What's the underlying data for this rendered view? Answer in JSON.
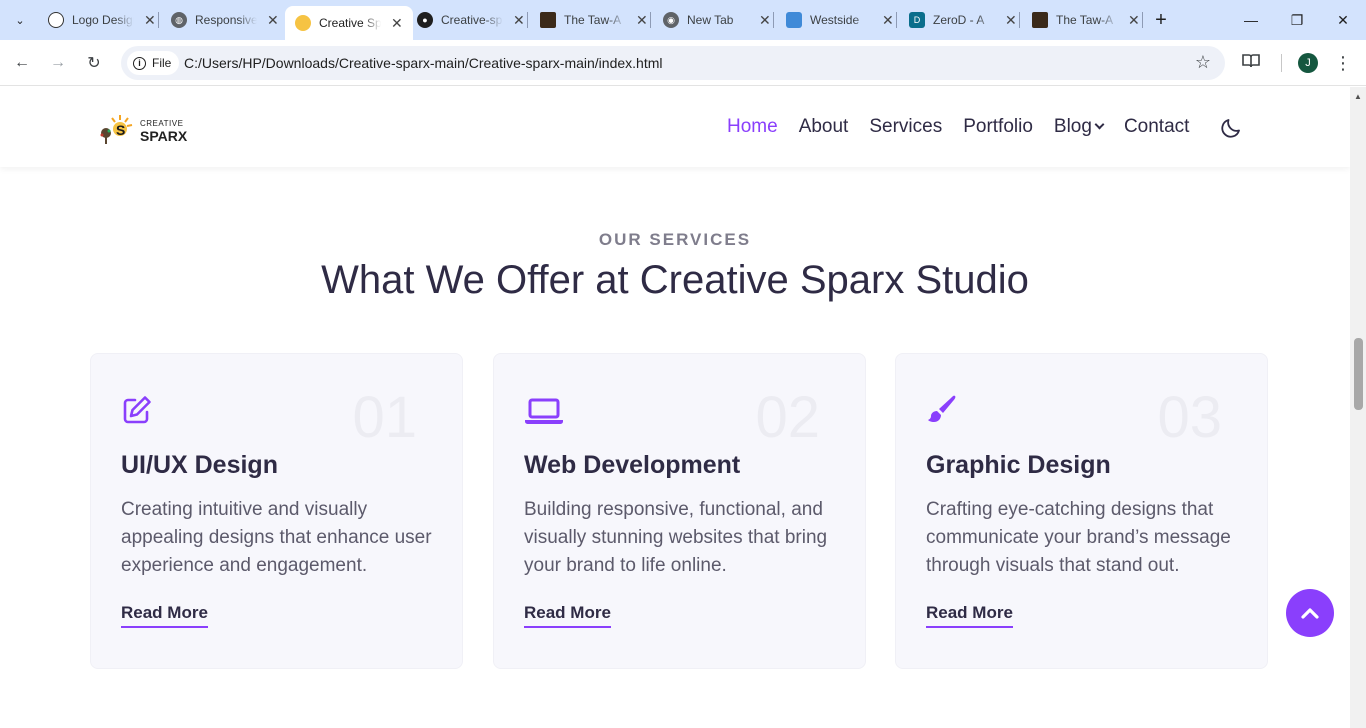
{
  "browser": {
    "tabs": [
      {
        "title": "Logo Design",
        "favicon": "openai-icon",
        "active": false
      },
      {
        "title": "Responsive",
        "favicon": "globe-icon",
        "active": false
      },
      {
        "title": "Creative Sparx",
        "favicon": "sparx-icon",
        "active": true
      },
      {
        "title": "Creative-sparx",
        "favicon": "github-icon",
        "active": false
      },
      {
        "title": "The Taw-A",
        "favicon": "taw-icon",
        "active": false
      },
      {
        "title": "New Tab",
        "favicon": "chrome-icon",
        "active": false
      },
      {
        "title": "Westside",
        "favicon": "westside-icon",
        "active": false
      },
      {
        "title": "ZeroD - A",
        "favicon": "zerod-icon",
        "active": false
      },
      {
        "title": "The Taw-A",
        "favicon": "taw-icon",
        "active": false
      }
    ],
    "chip_label": "File",
    "url": "C:/Users/HP/Downloads/Creative-sparx-main/Creative-sparx-main/index.html",
    "profile_initial": "J"
  },
  "site": {
    "logo": {
      "line1": "CREATIVE",
      "line2": "SPARX"
    },
    "nav": {
      "home": "Home",
      "about": "About",
      "services": "Services",
      "portfolio": "Portfolio",
      "blog": "Blog",
      "contact": "Contact"
    },
    "accent": "#8a3ffc"
  },
  "services": {
    "kicker": "OUR SERVICES",
    "title": "What We Offer at Creative Sparx Studio",
    "cards": [
      {
        "num": "01",
        "icon": "pen-square-icon",
        "title": "UI/UX Design",
        "desc": "Creating intuitive and visually appealing designs that enhance user experience and engagement.",
        "link": "Read More"
      },
      {
        "num": "02",
        "icon": "laptop-icon",
        "title": "Web Development",
        "desc": "Building responsive, functional, and visually stunning websites that bring your brand to life online.",
        "link": "Read More"
      },
      {
        "num": "03",
        "icon": "paintbrush-icon",
        "title": "Graphic Design",
        "desc": "Crafting eye-catching designs that communicate your brand’s message through visuals that stand out.",
        "link": "Read More"
      }
    ]
  }
}
